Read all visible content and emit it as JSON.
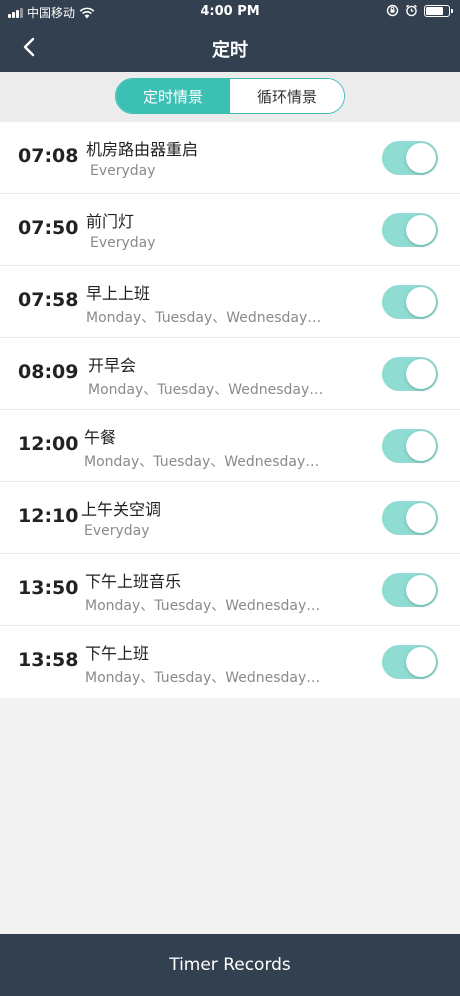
{
  "status_bar": {
    "carrier": "中国移动",
    "time": "4:00 PM"
  },
  "header": {
    "title": "定时"
  },
  "segments": {
    "active": "定时情景",
    "inactive": "循环情景"
  },
  "timers": [
    {
      "time": "07:08",
      "name": "机房路由器重启",
      "days": "Everyday"
    },
    {
      "time": "07:50",
      "name": "前门灯",
      "days": "Everyday"
    },
    {
      "time": "07:58",
      "name": "早上上班",
      "days": "Monday、Tuesday、Wednesday…"
    },
    {
      "time": "08:09",
      "name": "开早会",
      "days": "Monday、Tuesday、Wednesday…"
    },
    {
      "time": "12:00",
      "name": "午餐",
      "days": "Monday、Tuesday、Wednesday…"
    },
    {
      "time": "12:10",
      "name": "上午关空调",
      "days": "Everyday"
    },
    {
      "time": "13:50",
      "name": "下午上班音乐",
      "days": "Monday、Tuesday、Wednesday…"
    },
    {
      "time": "13:58",
      "name": "下午上班",
      "days": "Monday、Tuesday、Wednesday…"
    }
  ],
  "footer": {
    "label": "Timer Records"
  },
  "colors": {
    "header_bg": "#33404f",
    "accent": "#3cc0b4",
    "toggle_on": "#8fdcd3"
  }
}
